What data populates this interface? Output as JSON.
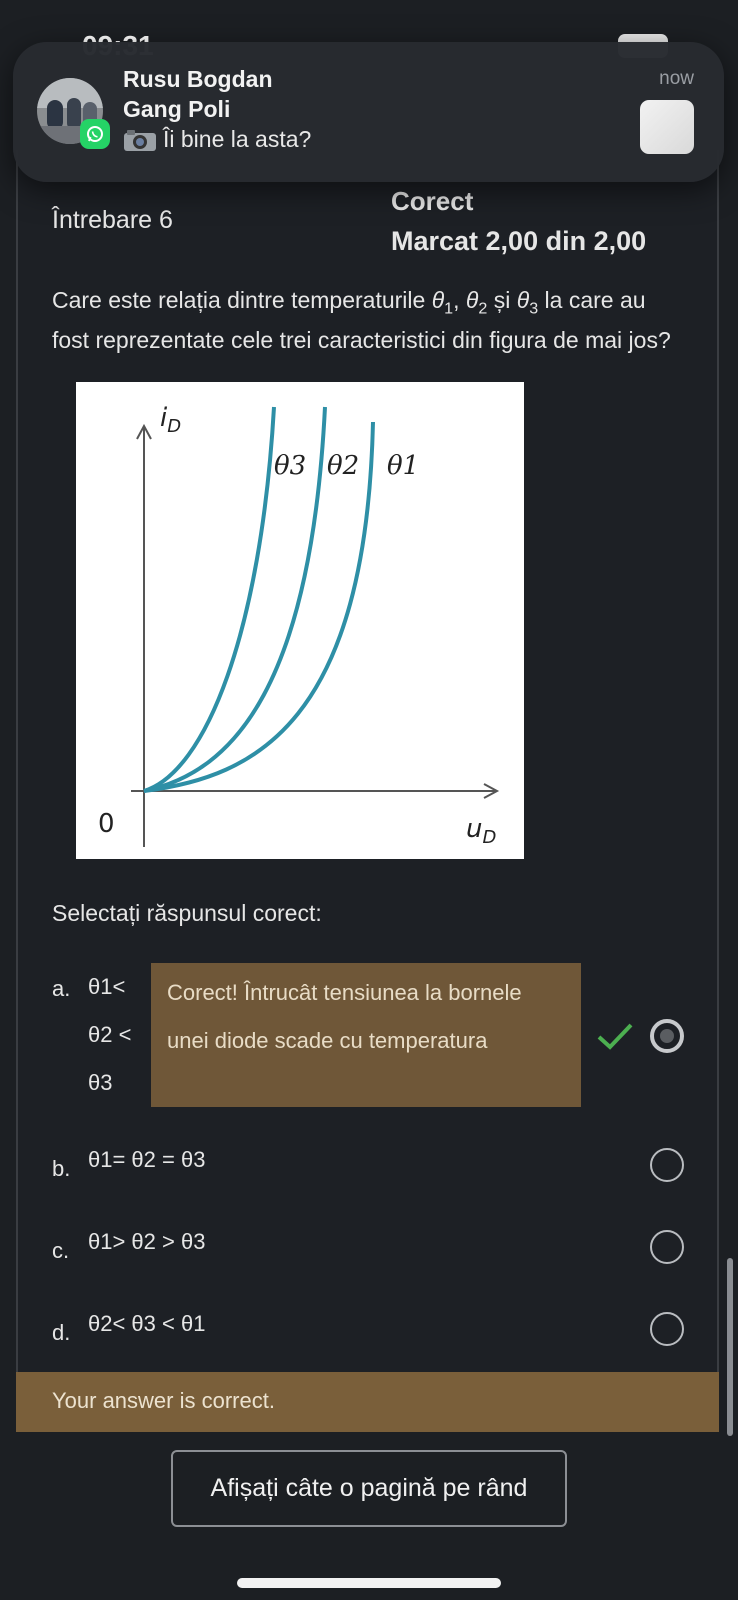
{
  "status_bar": {
    "time": "09:31",
    "battery": ""
  },
  "notification": {
    "sender": "Rusu Bogdan",
    "group": "Gang Poli",
    "message": "Îi bine la asta?",
    "time": "now",
    "app_icon": "whatsapp-icon",
    "attachment_icon": "camera-icon"
  },
  "question": {
    "number_label": "Întrebare 6",
    "status": "Corect",
    "grade": "Marcat 2,00 din 2,00",
    "text_before": "Care este relația dintre temperaturile ",
    "theta": "θ",
    "s1": "1",
    "s2": "2",
    "s3": "3",
    "sep_comma": ", ",
    "sep_and": " și ",
    "text_after": " la care au fost reprezentate cele trei caracteristici din figura de mai jos?"
  },
  "figure": {
    "y_axis_label": "i",
    "y_axis_sub": "D",
    "x_axis_label": "u",
    "x_axis_sub": "D",
    "origin_label": "0",
    "curve_labels": [
      "θ3",
      "θ2",
      "θ1"
    ],
    "curve_color": "#2e8fa6"
  },
  "select_prompt": "Selectați răspunsul corect:",
  "options": [
    {
      "letter": "a.",
      "lines": [
        "θ1<",
        "θ2 <",
        "θ3"
      ],
      "selected": true,
      "correct": true
    },
    {
      "letter": "b.",
      "text": "θ1= θ2 = θ3",
      "selected": false
    },
    {
      "letter": "c.",
      "text": "θ1> θ2 > θ3",
      "selected": false
    },
    {
      "letter": "d.",
      "text": "θ2< θ3 < θ1",
      "selected": false
    }
  ],
  "feedback": "Corect! Întrucât tensiunea la bornele unei diode scade cu temperatura",
  "result": "Your answer is correct.",
  "pager_button": "Afișați câte o pagină pe rând",
  "colors": {
    "background": "#1c1f23",
    "feedback_bg": "#6f5738",
    "result_bg": "#7a5f3a",
    "check_green": "#4caf50"
  }
}
